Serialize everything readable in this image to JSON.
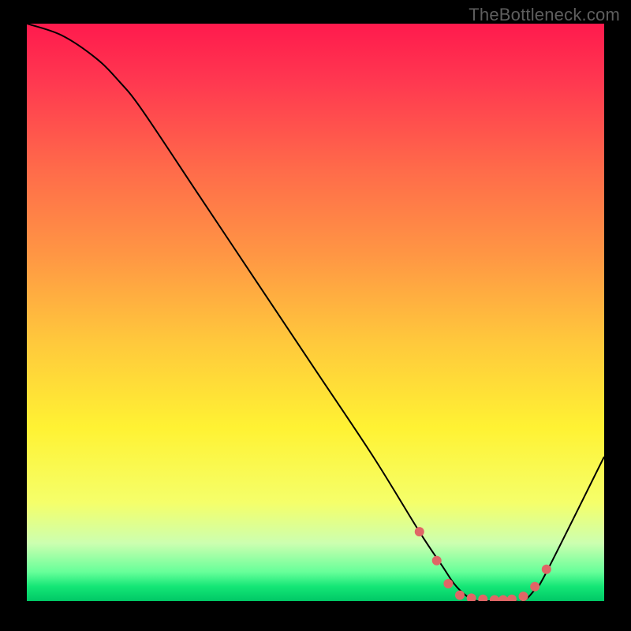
{
  "watermark": "TheBottleneck.com",
  "chart_data": {
    "type": "line",
    "title": "",
    "xlabel": "",
    "ylabel": "",
    "xlim": [
      0,
      100
    ],
    "ylim": [
      0,
      100
    ],
    "series": [
      {
        "name": "curve",
        "x": [
          0,
          6,
          12,
          16,
          20,
          30,
          40,
          50,
          60,
          68,
          72,
          74,
          76,
          78,
          80,
          82,
          84,
          86,
          88,
          90,
          100
        ],
        "y": [
          100,
          98,
          94,
          90,
          85,
          70,
          55,
          40,
          25,
          12,
          6,
          3,
          1,
          0,
          0,
          0,
          0,
          0,
          2,
          5,
          25
        ]
      }
    ],
    "markers": {
      "name": "dots",
      "x": [
        68,
        71,
        73,
        75,
        77,
        79,
        81,
        82.5,
        84,
        86,
        88,
        90
      ],
      "y": [
        12,
        7,
        3,
        1,
        0.5,
        0.3,
        0.2,
        0.2,
        0.3,
        0.8,
        2.5,
        5.5
      ]
    },
    "gradient_stops": [
      {
        "offset": 0.0,
        "color": "#ff1a4d"
      },
      {
        "offset": 0.1,
        "color": "#ff3850"
      },
      {
        "offset": 0.25,
        "color": "#ff6a4a"
      },
      {
        "offset": 0.4,
        "color": "#ff9644"
      },
      {
        "offset": 0.55,
        "color": "#ffc83c"
      },
      {
        "offset": 0.7,
        "color": "#fff233"
      },
      {
        "offset": 0.83,
        "color": "#f5ff6a"
      },
      {
        "offset": 0.9,
        "color": "#ccffb0"
      },
      {
        "offset": 0.95,
        "color": "#66ff99"
      },
      {
        "offset": 0.975,
        "color": "#14e676"
      },
      {
        "offset": 1.0,
        "color": "#00c866"
      }
    ],
    "curve_color": "#000000",
    "marker_color": "#e06666",
    "marker_radius": 6
  }
}
